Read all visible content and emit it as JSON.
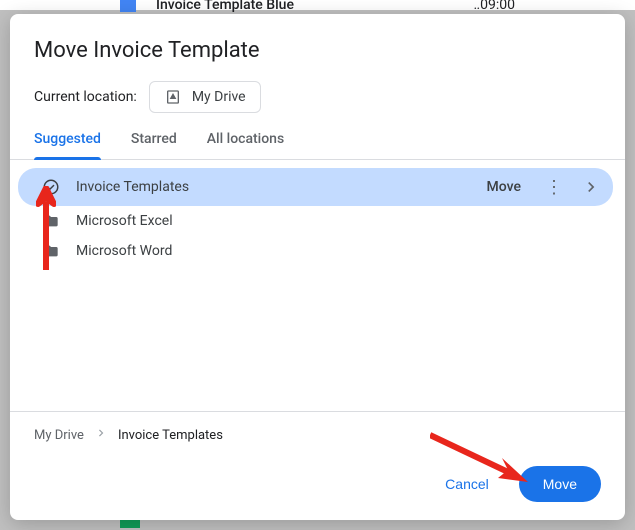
{
  "background": {
    "filename": "Invoice Template Blue",
    "time": "09:00"
  },
  "dialog": {
    "title": "Move Invoice Template",
    "locationLabel": "Current location:",
    "currentLocation": "My Drive"
  },
  "tabs": [
    {
      "label": "Suggested",
      "active": true
    },
    {
      "label": "Starred",
      "active": false
    },
    {
      "label": "All locations",
      "active": false
    }
  ],
  "folders": [
    {
      "name": "Invoice Templates",
      "selected": true,
      "icon": "check-circle",
      "actionLabel": "Move"
    },
    {
      "name": "Microsoft Excel",
      "selected": false,
      "icon": "folder"
    },
    {
      "name": "Microsoft Word",
      "selected": false,
      "icon": "folder"
    }
  ],
  "breadcrumb": {
    "root": "My Drive",
    "current": "Invoice Templates"
  },
  "buttons": {
    "cancel": "Cancel",
    "move": "Move"
  }
}
